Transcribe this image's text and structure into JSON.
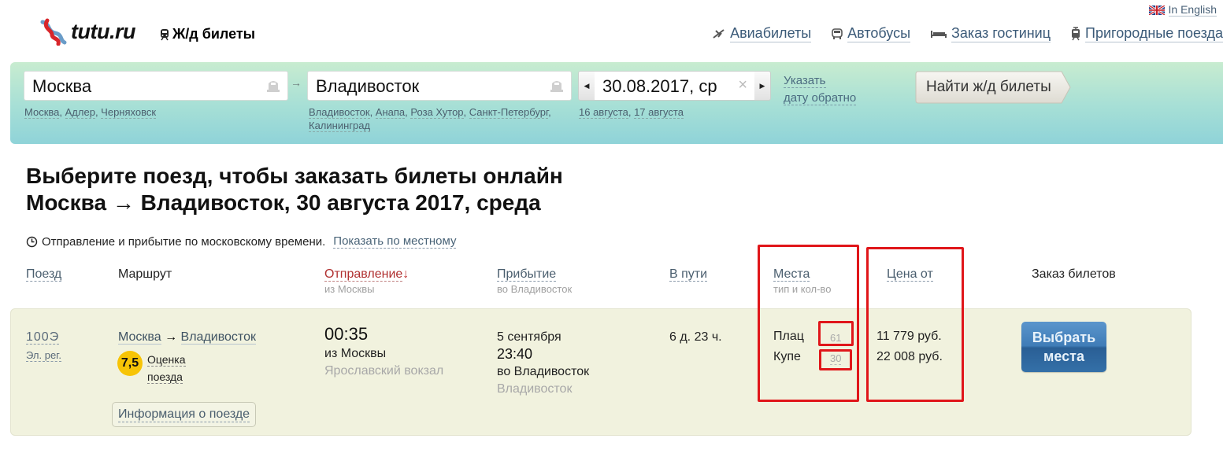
{
  "header": {
    "logo_text": "tutu.ru",
    "section_title": "Ж/д билеты",
    "language_link": "In English",
    "nav": [
      {
        "icon": "airplane-icon",
        "label": "Авиабилеты"
      },
      {
        "icon": "bus-icon",
        "label": "Автобусы"
      },
      {
        "icon": "bed-icon",
        "label": "Заказ гостиниц"
      },
      {
        "icon": "suburban-train-icon",
        "label": "Пригородные поезда"
      }
    ]
  },
  "search": {
    "from_value": "Москва",
    "from_suggestions": [
      "Москва",
      "Адлер",
      "Черняховск"
    ],
    "to_value": "Владивосток",
    "to_suggestions": [
      "Владивосток",
      "Анапа",
      "Роза Хутор",
      "Санкт-Петербург",
      "Калининград"
    ],
    "date_value": "30.08.2017, ср",
    "date_suggestions": [
      "16 августа",
      "17 августа"
    ],
    "return_date_line1": "Указать",
    "return_date_line2": "дату обратно",
    "submit_label": "Найти ж/д билеты"
  },
  "page": {
    "heading_line1": "Выберите поезд, чтобы заказать билеты онлайн",
    "heading_line2": "Москва → Владивосток, 30 августа 2017, среда",
    "time_note": "Отправление и прибытие по московскому времени.",
    "time_toggle": "Показать по местному"
  },
  "table": {
    "headers": {
      "train": "Поезд",
      "route": "Маршрут",
      "departure": "Отправление",
      "departure_sub": "из Москвы",
      "departure_sort": "↓",
      "arrival": "Прибытие",
      "arrival_sub": "во Владивосток",
      "duration": "В пути",
      "seats": "Места",
      "seats_sub": "тип и кол-во",
      "price": "Цена от",
      "order": "Заказ билетов"
    },
    "rows": [
      {
        "train_number": "100Э",
        "train_type": "Эл. рег.",
        "route_from": "Москва",
        "route_arrow": "→",
        "route_to": "Владивосток",
        "rating": "7,5",
        "rating_label_1": "Оценка",
        "rating_label_2": "поезда",
        "info_button": "Информация о поезде",
        "departure_time": "00:35",
        "departure_city": "из Москвы",
        "departure_station": "Ярославский вокзал",
        "arrival_date": "5 сентября",
        "arrival_time": "23:40",
        "arrival_city": "во Владивосток",
        "arrival_station": "Владивосток",
        "duration": "6 д. 23 ч.",
        "seats": [
          {
            "type": "Плац",
            "count": "61",
            "price": "11 779 руб."
          },
          {
            "type": "Купе",
            "count": "30",
            "price": "22 008 руб."
          }
        ],
        "choose_button": "Выбрать места"
      }
    ]
  },
  "colors": {
    "accent_link": "#3b5a78",
    "sort_active": "#b03030",
    "rating_badge": "#f7c406",
    "row_background": "#f1f2de",
    "button_blue": "#3f7cb7",
    "highlight_red": "#e0161a"
  }
}
